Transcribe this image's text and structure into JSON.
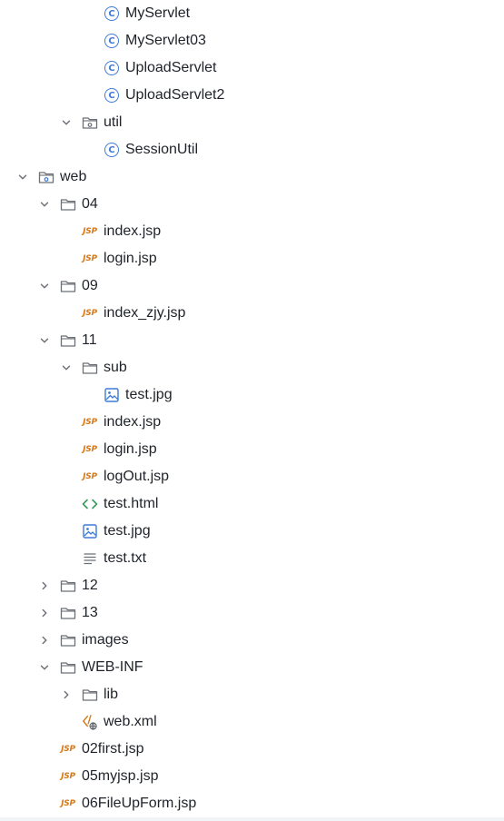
{
  "tree": [
    {
      "label": "MyServlet",
      "icon": "java-class-icon",
      "depth": 4,
      "chevron": "none"
    },
    {
      "label": "MyServlet03",
      "icon": "java-class-icon",
      "depth": 4,
      "chevron": "none"
    },
    {
      "label": "UploadServlet",
      "icon": "java-class-icon",
      "depth": 4,
      "chevron": "none"
    },
    {
      "label": "UploadServlet2",
      "icon": "java-class-icon",
      "depth": 4,
      "chevron": "none"
    },
    {
      "label": "util",
      "icon": "package-icon",
      "depth": 3,
      "chevron": "expanded"
    },
    {
      "label": "SessionUtil",
      "icon": "java-class-icon",
      "depth": 4,
      "chevron": "none"
    },
    {
      "label": "web",
      "icon": "web-folder-icon",
      "depth": 1,
      "chevron": "expanded"
    },
    {
      "label": "04",
      "icon": "folder-icon",
      "depth": 2,
      "chevron": "expanded"
    },
    {
      "label": "index.jsp",
      "icon": "jsp-icon",
      "depth": 3,
      "chevron": "none"
    },
    {
      "label": "login.jsp",
      "icon": "jsp-icon",
      "depth": 3,
      "chevron": "none"
    },
    {
      "label": "09",
      "icon": "folder-icon",
      "depth": 2,
      "chevron": "expanded"
    },
    {
      "label": "index_zjy.jsp",
      "icon": "jsp-icon",
      "depth": 3,
      "chevron": "none"
    },
    {
      "label": "11",
      "icon": "folder-icon",
      "depth": 2,
      "chevron": "expanded"
    },
    {
      "label": "sub",
      "icon": "folder-icon",
      "depth": 3,
      "chevron": "expanded"
    },
    {
      "label": "test.jpg",
      "icon": "image-icon",
      "depth": 4,
      "chevron": "none"
    },
    {
      "label": "index.jsp",
      "icon": "jsp-icon",
      "depth": 3,
      "chevron": "none"
    },
    {
      "label": "login.jsp",
      "icon": "jsp-icon",
      "depth": 3,
      "chevron": "none"
    },
    {
      "label": "logOut.jsp",
      "icon": "jsp-icon",
      "depth": 3,
      "chevron": "none"
    },
    {
      "label": "test.html",
      "icon": "html-icon",
      "depth": 3,
      "chevron": "none"
    },
    {
      "label": "test.jpg",
      "icon": "image-icon",
      "depth": 3,
      "chevron": "none"
    },
    {
      "label": "test.txt",
      "icon": "text-file-icon",
      "depth": 3,
      "chevron": "none"
    },
    {
      "label": "12",
      "icon": "folder-icon",
      "depth": 2,
      "chevron": "collapsed"
    },
    {
      "label": "13",
      "icon": "folder-icon",
      "depth": 2,
      "chevron": "collapsed"
    },
    {
      "label": "images",
      "icon": "folder-icon",
      "depth": 2,
      "chevron": "collapsed"
    },
    {
      "label": "WEB-INF",
      "icon": "folder-icon",
      "depth": 2,
      "chevron": "expanded"
    },
    {
      "label": "lib",
      "icon": "folder-icon",
      "depth": 3,
      "chevron": "collapsed"
    },
    {
      "label": "web.xml",
      "icon": "web-xml-icon",
      "depth": 3,
      "chevron": "none"
    },
    {
      "label": "02first.jsp",
      "icon": "jsp-icon",
      "depth": 2,
      "chevron": "none"
    },
    {
      "label": "05myjsp.jsp",
      "icon": "jsp-icon",
      "depth": 2,
      "chevron": "none"
    },
    {
      "label": "06FileUpForm.jsp",
      "icon": "jsp-icon",
      "depth": 2,
      "chevron": "none"
    }
  ],
  "colors": {
    "text": "#1f2329",
    "folder_stroke": "#6b6f76",
    "jsp": "#d4791a",
    "java_class": "#3d7bd9",
    "image": "#3d7bd9",
    "html": "#3a9a5a",
    "chevron": "#6b6f76"
  }
}
